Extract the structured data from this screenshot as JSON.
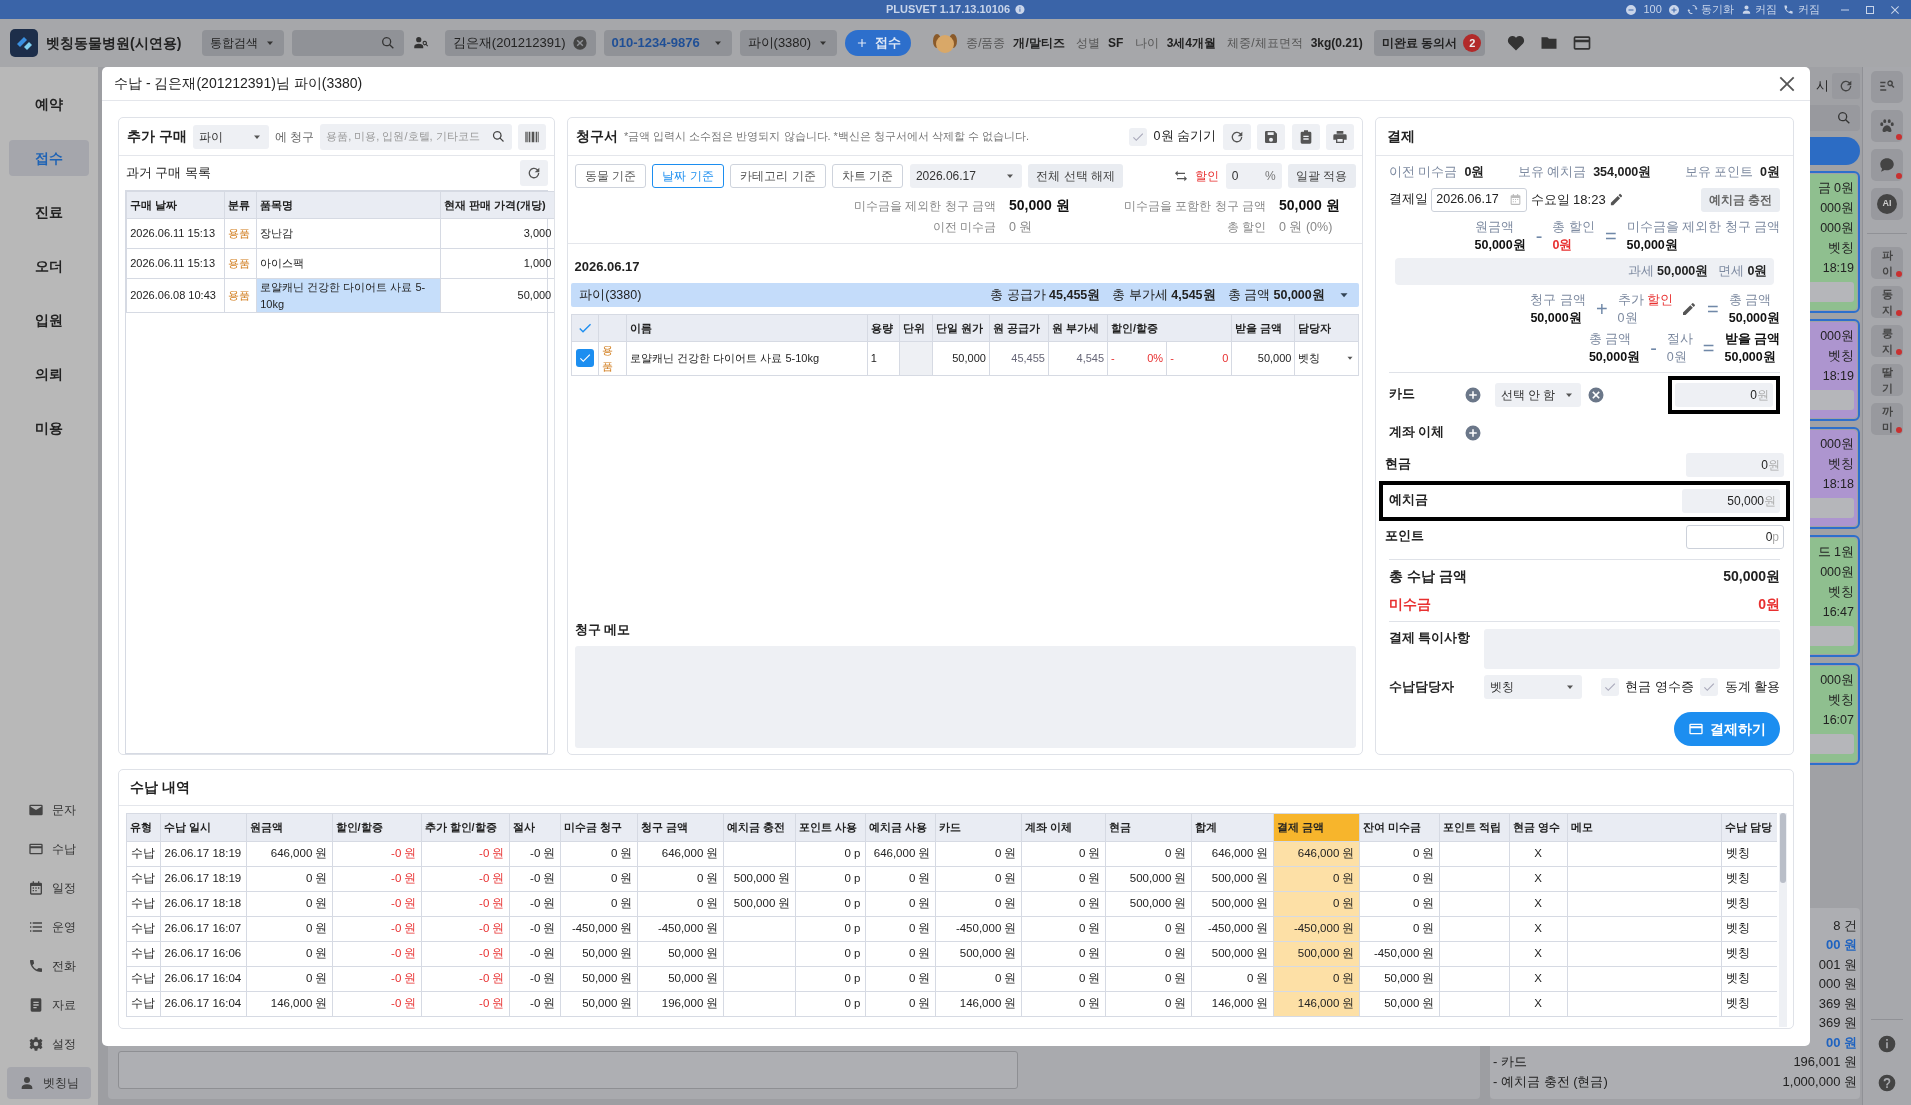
{
  "top_strip": {
    "title": "PLUSVET 1.17.13.10106",
    "zoom": "100",
    "actions": [
      {
        "kind": "sync",
        "label": "동기화"
      },
      {
        "kind": "user",
        "label": "커짐"
      },
      {
        "kind": "phone",
        "label": "커짐"
      }
    ]
  },
  "app_bar": {
    "clinic": "벳칭동물병원(시연용)",
    "search_scope": "통합검색",
    "client": "김은재(201212391)",
    "phone": "010-1234-9876",
    "pet": "파이(3380)",
    "register_button": "접수",
    "pet_info": [
      {
        "label": "종/품종",
        "value": "개/말티즈"
      },
      {
        "label": "성별",
        "value": "SF"
      },
      {
        "label": "나이",
        "value": "3세4개월"
      },
      {
        "label": "체중/체표면적",
        "value": "3kg(0.21)"
      }
    ],
    "consent": {
      "label": "미완료 동의서",
      "count": "2"
    }
  },
  "sidebar": {
    "items": [
      {
        "label": "예약",
        "selected": false
      },
      {
        "label": "접수",
        "selected": true
      },
      {
        "label": "진료",
        "selected": false
      },
      {
        "label": "오더",
        "selected": false
      },
      {
        "label": "입원",
        "selected": false
      },
      {
        "label": "의뢰",
        "selected": false
      },
      {
        "label": "미용",
        "selected": false
      }
    ],
    "tools": [
      {
        "kind": "mail",
        "label": "문자"
      },
      {
        "kind": "card",
        "label": "수납"
      },
      {
        "kind": "calendar",
        "label": "일정"
      },
      {
        "kind": "list",
        "label": "운영"
      },
      {
        "kind": "phone",
        "label": "전화"
      },
      {
        "kind": "doc",
        "label": "자료"
      },
      {
        "kind": "gear",
        "label": "설정"
      }
    ],
    "user": "벳칭님"
  },
  "background_panel": {
    "header_fragment": "시",
    "cards": [
      {
        "color": "#8fbf8f",
        "lines": [
          "금 0원",
          "000원",
          "000원",
          "벳칭",
          "18:19"
        ]
      },
      {
        "color": "#ad95cf",
        "lines": [
          "000원",
          "벳칭",
          "18:19"
        ]
      },
      {
        "color": "#ad95cf",
        "lines": [
          "000원",
          "벳칭",
          "18:18"
        ]
      },
      {
        "color": "#8fbf8f",
        "lines": [
          "드 1원",
          "000원",
          "벳칭",
          "16:47"
        ]
      },
      {
        "color": "#8fbf8f",
        "lines": [
          "000원",
          "벳칭",
          "16:07"
        ]
      }
    ],
    "summary": [
      {
        "text": "8 건",
        "accent": false
      },
      {
        "text": "00 원",
        "accent": true
      },
      {
        "text": "001 원",
        "accent": false
      },
      {
        "text": "000 원",
        "accent": false
      },
      {
        "text": "369 원",
        "accent": false
      },
      {
        "text": "369 원",
        "accent": false
      },
      {
        "text": "00 원",
        "accent": true
      }
    ],
    "details": [
      {
        "label": "- 카드",
        "value": "196,001 원"
      },
      {
        "label": "- 예치금 충전 (현금)",
        "value": "1,000,000 원"
      }
    ]
  },
  "right_bar": {
    "tools": [
      {
        "kind": "list-search",
        "alert": false
      },
      {
        "kind": "paw",
        "alert": true
      },
      {
        "kind": "chat",
        "alert": true
      },
      {
        "kind": "ai",
        "label": "AI",
        "alert": false
      }
    ],
    "pets": [
      {
        "label": "파이",
        "alert": true
      },
      {
        "label": "동지",
        "alert": true
      },
      {
        "label": "룽지",
        "alert": true
      },
      {
        "label": "딸기",
        "alert": false
      },
      {
        "label": "까미",
        "alert": true
      }
    ],
    "help": [
      {
        "kind": "info"
      },
      {
        "kind": "help"
      }
    ]
  },
  "modal": {
    "title": "수납 - 김은재(201212391)님 파이(3380)",
    "purchase": {
      "title": "추가 구매",
      "pet": "파이",
      "charge_to": "에 청구",
      "search_placeholder": "용품, 미용, 입원/호텔, 기타코드",
      "past_title": "과거 구매 목록",
      "columns": [
        "구매 날짜",
        "분류",
        "품목명",
        "현재 판매 가격(개당)"
      ],
      "rows": [
        {
          "date": "2026.06.11 15:13",
          "category": "용품",
          "name": "장난감",
          "price": "3,000",
          "selected": false
        },
        {
          "date": "2026.06.11 15:13",
          "category": "용품",
          "name": "아이스팩",
          "price": "1,000",
          "selected": false
        },
        {
          "date": "2026.06.08 10:43",
          "category": "용품",
          "name": "로얄캐닌 건강한 다이어트 사료 5-10kg",
          "price": "50,000",
          "selected": true
        }
      ]
    },
    "bill": {
      "title": "청구서",
      "note": "*금액 입력시 소수점은 반영되지 않습니다. *백신은 청구서에서 삭제할 수 없습니다.",
      "hide_zero": {
        "label": "0원 숨기기",
        "checked": false
      },
      "views": [
        {
          "label": "동물 기준",
          "selected": false
        },
        {
          "label": "날짜 기준",
          "selected": true
        },
        {
          "label": "카테고리 기준",
          "selected": false
        },
        {
          "label": "차트 기준",
          "selected": false
        }
      ],
      "date": "2026.06.17",
      "deselect_button": "전체 선택 해제",
      "discount_label": "할인",
      "discount_value": "0",
      "discount_unit": "%",
      "apply_button": "일괄 적용",
      "summary": [
        {
          "label": "미수금을 제외한 청구 금액",
          "value": "50,000 원",
          "strong": true
        },
        {
          "label": "미수금을 포함한 청구 금액",
          "value": "50,000 원",
          "strong": true
        },
        {
          "label": "이전 미수금",
          "value": "0 원",
          "strong": false
        },
        {
          "label": "총 할인",
          "value": "0 원 (0%)",
          "strong": false
        }
      ],
      "group_date": "2026.06.17",
      "group": {
        "pet": "파이(3380)",
        "totals": [
          {
            "label": "총 공급가",
            "value": "45,455원"
          },
          {
            "label": "총 부가세",
            "value": "4,545원"
          },
          {
            "label": "총 금액",
            "value": "50,000원"
          }
        ]
      },
      "select_all": {
        "checked": true
      },
      "columns": [
        "이름",
        "용량",
        "단위",
        "단일 원가",
        "원 공급가",
        "원 부가세",
        "할인/할증",
        "받을 금액",
        "담당자"
      ],
      "items": [
        {
          "checked": true,
          "category": "용품",
          "name": "로얄캐닌 건강한 다이어트 사료 5-10kg",
          "quantity": "1",
          "unit_price": "50,000",
          "supply": "45,455",
          "vat": "4,545",
          "pct_sign": "-",
          "pct": "0%",
          "amt_sign": "-",
          "amt": "0",
          "receivable": "50,000",
          "staff": "벳칭"
        }
      ],
      "memo_title": "청구 메모"
    },
    "payment": {
      "title": "결제",
      "balances": [
        {
          "label": "이전 미수금",
          "value": "0원"
        },
        {
          "label": "보유 예치금",
          "value": "354,000원"
        },
        {
          "label": "보유 포인트",
          "value": "0원"
        }
      ],
      "date_label": "결제일",
      "date": "2026.06.17",
      "weekday_time": "수요일 18:23",
      "deposit_button": "예치금 충전",
      "equations": [
        {
          "terms": [
            {
              "label": "원금액",
              "value": "50,000원",
              "red": false,
              "muted": false
            },
            {
              "label": "총 할인",
              "value": "0원",
              "red": true,
              "muted": false
            },
            {
              "label": "미수금을 제외한 청구 금액",
              "value": "50,000원",
              "red": false,
              "muted": false
            }
          ],
          "ops": [
            "-",
            "="
          ]
        },
        {
          "terms": [
            {
              "label": "청구 금액",
              "value": "50,000원",
              "red": false,
              "muted": false
            },
            {
              "label": "추가",
              "label_accent": "할인",
              "value": "0원",
              "red": false,
              "muted": true,
              "editable": true
            },
            {
              "label": "총 금액",
              "value": "50,000원",
              "red": false,
              "muted": false
            }
          ],
          "ops": [
            "+",
            "="
          ]
        },
        {
          "terms": [
            {
              "label": "총 금액",
              "value": "50,000원",
              "red": false,
              "muted": false
            },
            {
              "label": "절사",
              "value": "0원",
              "red": false,
              "muted": true
            },
            {
              "label": "받을 금액",
              "value": "50,000원",
              "red": false,
              "muted": false,
              "strong": true
            }
          ],
          "ops": [
            "-",
            "="
          ]
        }
      ],
      "tax": [
        {
          "label": "과세",
          "value": "50,000원"
        },
        {
          "label": "면세",
          "value": "0원"
        }
      ],
      "methods": [
        {
          "kind": "card",
          "label": "카드",
          "select": "선택 안 함",
          "amount": "0",
          "unit": "원",
          "outlined": true,
          "readonly": true
        },
        {
          "kind": "transfer",
          "label": "계좌 이체"
        },
        {
          "kind": "amount",
          "label": "현금",
          "amount": "0",
          "unit": "원",
          "outlined": false,
          "readonly": true
        },
        {
          "kind": "amount",
          "label": "예치금",
          "amount": "50,000",
          "unit": "원",
          "outlined": true,
          "readonly": true
        },
        {
          "kind": "amount",
          "label": "포인트",
          "amount": "0",
          "unit": "p",
          "outlined": false,
          "readonly": false
        }
      ],
      "total": {
        "label": "총 수납 금액",
        "value": "50,000원"
      },
      "unpaid": {
        "label": "미수금",
        "value": "0원"
      },
      "memo_label": "결제 특이사항",
      "staff_label": "수납담당자",
      "staff": "벳칭",
      "options": [
        {
          "label": "현금 영수증",
          "checked": false
        },
        {
          "label": "동계 활용",
          "checked": false
        }
      ],
      "pay_button": "결제하기"
    },
    "history": {
      "title": "수납 내역",
      "columns": [
        {
          "label": "유형",
          "kind": "text"
        },
        {
          "label": "수납 일시",
          "kind": "text"
        },
        {
          "label": "원금액",
          "kind": "money"
        },
        {
          "label": "할인/할증",
          "kind": "discount"
        },
        {
          "label": "추가 할인/할증",
          "kind": "discount"
        },
        {
          "label": "절사",
          "kind": "money"
        },
        {
          "label": "미수금 청구",
          "kind": "money"
        },
        {
          "label": "청구 금액",
          "kind": "money"
        },
        {
          "label": "예치금 충전",
          "kind": "money"
        },
        {
          "label": "포인트 사용",
          "kind": "money"
        },
        {
          "label": "예치금 사용",
          "kind": "money"
        },
        {
          "label": "카드",
          "kind": "money"
        },
        {
          "label": "계좌 이체",
          "kind": "money"
        },
        {
          "label": "현금",
          "kind": "money"
        },
        {
          "label": "합계",
          "kind": "money"
        },
        {
          "label": "결제 금액",
          "kind": "result"
        },
        {
          "label": "잔여 미수금",
          "kind": "money"
        },
        {
          "label": "포인트 적립",
          "kind": "money"
        },
        {
          "label": "현금 영수",
          "kind": "center"
        },
        {
          "label": "메모",
          "kind": "text"
        },
        {
          "label": "수납 담당",
          "kind": "text"
        }
      ],
      "rows": [
        [
          "수납",
          "26.06.17 18:19",
          "646,000 원",
          "-0 원",
          "-0 원",
          "-0 원",
          "0 원",
          "646,000 원",
          null,
          "0 p",
          "646,000 원",
          "0 원",
          "0 원",
          "0 원",
          "646,000 원",
          "646,000 원",
          "0 원",
          null,
          "X",
          null,
          "벳칭"
        ],
        [
          "수납",
          "26.06.17 18:19",
          "0 원",
          "-0 원",
          "-0 원",
          "-0 원",
          "0 원",
          "0 원",
          "500,000 원",
          "0 p",
          "0 원",
          "0 원",
          "0 원",
          "500,000 원",
          "500,000 원",
          "0 원",
          "0 원",
          null,
          "X",
          null,
          "벳칭"
        ],
        [
          "수납",
          "26.06.17 18:18",
          "0 원",
          "-0 원",
          "-0 원",
          "-0 원",
          "0 원",
          "0 원",
          "500,000 원",
          "0 p",
          "0 원",
          "0 원",
          "0 원",
          "500,000 원",
          "500,000 원",
          "0 원",
          "0 원",
          null,
          "X",
          null,
          "벳칭"
        ],
        [
          "수납",
          "26.06.17 16:07",
          "0 원",
          "-0 원",
          "-0 원",
          "-0 원",
          "-450,000 원",
          "-450,000 원",
          null,
          "0 p",
          "0 원",
          "-450,000 원",
          "0 원",
          "0 원",
          "-450,000 원",
          "-450,000 원",
          "0 원",
          null,
          "X",
          null,
          "벳칭"
        ],
        [
          "수납",
          "26.06.17 16:06",
          "0 원",
          "-0 원",
          "-0 원",
          "-0 원",
          "50,000 원",
          "50,000 원",
          null,
          "0 p",
          "0 원",
          "500,000 원",
          "0 원",
          "0 원",
          "500,000 원",
          "500,000 원",
          "-450,000 원",
          null,
          "X",
          null,
          "벳칭"
        ],
        [
          "수납",
          "26.06.17 16:04",
          "0 원",
          "-0 원",
          "-0 원",
          "-0 원",
          "50,000 원",
          "50,000 원",
          null,
          "0 p",
          "0 원",
          "0 원",
          "0 원",
          "0 원",
          "0 원",
          "0 원",
          "50,000 원",
          null,
          "X",
          null,
          "벳칭"
        ],
        [
          "수납",
          "26.06.17 16:04",
          "146,000 원",
          "-0 원",
          "-0 원",
          "-0 원",
          "50,000 원",
          "196,000 원",
          null,
          "0 p",
          "0 원",
          "146,000 원",
          "0 원",
          "0 원",
          "146,000 원",
          "146,000 원",
          "50,000 원",
          null,
          "X",
          null,
          "벳칭"
        ]
      ]
    }
  }
}
